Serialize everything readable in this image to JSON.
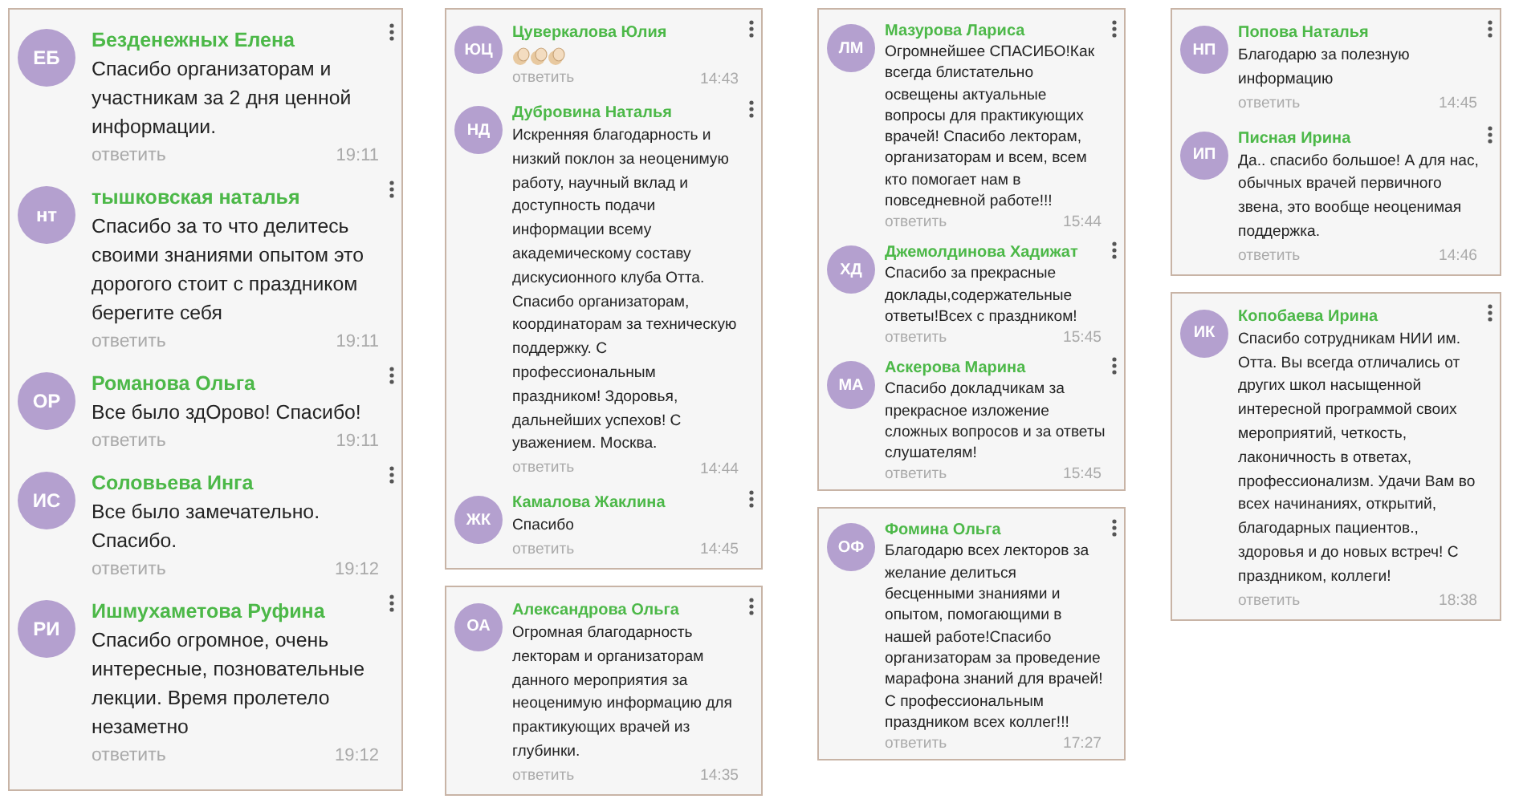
{
  "columns": [
    {
      "panels": [
        {
          "messages": [
            {
              "initials": "ЕБ",
              "author": "Безденежных Елена",
              "text": "Спасибо организаторам и участникам за 2 дня ценной информации.",
              "reply": "ответить",
              "time": "19:11"
            },
            {
              "initials": "нт",
              "author": "тышковская наталья",
              "text": "Спасибо за то что делитесь своими знаниями опытом это дорогого стоит с праздником берегите себя",
              "reply": "ответить",
              "time": "19:11"
            },
            {
              "initials": "ОР",
              "author": "Романова Ольга",
              "text": "Все было здОрово! Спасибо!",
              "reply": "ответить",
              "time": "19:11"
            },
            {
              "initials": "ИС",
              "author": "Соловьева Инга",
              "text": "Все было замечательно. Спасибо.",
              "reply": "ответить",
              "time": "19:12"
            },
            {
              "initials": "РИ",
              "author": "Ишмухаметова Руфина",
              "text": "Спасибо огромное, очень интересные, позновательные лекции. Время пролетело незаметно",
              "reply": "ответить",
              "time": "19:12"
            }
          ]
        }
      ]
    },
    {
      "panels": [
        {
          "messages": [
            {
              "initials": "ЮЦ",
              "author": "Цуверкалова Юлия",
              "kind": "sticker",
              "reply": "ответить",
              "time": "14:43"
            },
            {
              "initials": "НД",
              "author": "Дубровина Наталья",
              "text": "Искренняя благодарность и низкий поклон за неоценимую работу, научный вклад и доступность подачи информации всему академическому составу дискусионного клуба Отта. Спасибо организаторам, координаторам за техническую поддержку. С профессиональным праздником! Здоровья, дальнейших успехов! С уважением. Москва.",
              "reply": "ответить",
              "time": "14:44"
            },
            {
              "initials": "ЖК",
              "author": "Камалова Жаклина",
              "text": "Спасибо",
              "reply": "ответить",
              "time": "14:45"
            }
          ]
        },
        {
          "messages": [
            {
              "initials": "ОА",
              "author": "Александрова Ольга",
              "text": "Огромная благодарность лекторам и организаторам данного мероприятия за неоценимую информацию для практикующих врачей из глубинки.",
              "reply": "ответить",
              "time": "14:35"
            }
          ]
        }
      ]
    },
    {
      "panels": [
        {
          "messages": [
            {
              "initials": "ЛМ",
              "author": "Мазурова Лариса",
              "text": "Огромнейшее СПАСИБО!Как всегда блистательно освещены актуальные вопросы для практикующих врачей! Спасибо лекторам, организаторам и всем, всем кто помогает нам в повседневной работе!!!",
              "reply": "ответить",
              "time": "15:44"
            },
            {
              "initials": "ХД",
              "author": "Джемолдинова Хадижат",
              "text": "Спасибо за прекрасные доклады,содержательные ответы!Всех с праздником!",
              "reply": "ответить",
              "time": "15:45"
            },
            {
              "initials": "МА",
              "author": "Аскерова Марина",
              "text": "Спасибо докладчикам за прекрасное изложение сложных вопросов и за ответы слушателям!",
              "reply": "ответить",
              "time": "15:45"
            }
          ]
        },
        {
          "messages": [
            {
              "initials": "ОФ",
              "author": "Фомина Ольга",
              "text": "Благодарю всех лекторов за желание делиться бесценными знаниями и опытом, помогающими в нашей работе!Спасибо организаторам за проведение марафона знаний для врачей! С профессиональным праздником всех коллег!!!",
              "reply": "ответить",
              "time": "17:27"
            }
          ]
        }
      ]
    },
    {
      "panels": [
        {
          "messages": [
            {
              "initials": "НП",
              "author": "Попова Наталья",
              "text": "Благодарю за полезную информацию",
              "reply": "ответить",
              "time": "14:45"
            },
            {
              "initials": "ИП",
              "author": "Писная Ирина",
              "text": "Да.. спасибо большое! А для нас, обычных врачей первичного звена, это вообще неоценимая поддержка.",
              "reply": "ответить",
              "time": "14:46"
            }
          ]
        },
        {
          "messages": [
            {
              "initials": "ИК",
              "author": "Копобаева Ирина",
              "text": "Спасибо сотрудникам НИИ им. Отта. Вы всегда отличались от других школ насыщенной интересной программой своих мероприятий, четкость, лаконичность в ответах, профессионализм. Удачи Вам во всех начинаниях, открытий, благодарных пациентов., здоровья и до новых встреч! С праздником, коллеги!",
              "reply": "ответить",
              "time": "18:38"
            }
          ]
        }
      ]
    }
  ]
}
